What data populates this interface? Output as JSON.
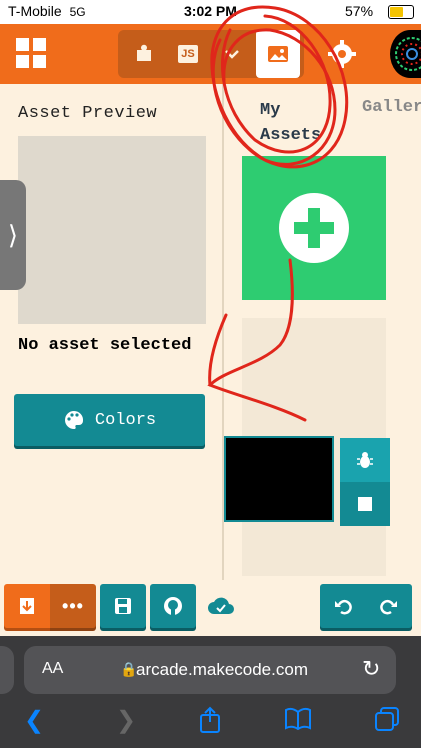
{
  "status_bar": {
    "carrier": "T-Mobile",
    "network": "5G",
    "time": "3:02 PM",
    "battery": "57%"
  },
  "toolbar": {
    "js_label": "JS",
    "accent": "#f06c1b"
  },
  "asset_preview": {
    "title": "Asset Preview",
    "empty_text": "No asset selected"
  },
  "colors_button": {
    "label": "Colors"
  },
  "tabs": {
    "my_assets": [
      "My",
      "Assets"
    ],
    "gallery": "Galler"
  },
  "browser": {
    "aa": "AA",
    "url": "arcade.makecode.com"
  },
  "colors": {
    "teal": "#138a93",
    "green": "#2ecc71",
    "orange": "#f06c1b",
    "annotation": "#e0261b"
  }
}
